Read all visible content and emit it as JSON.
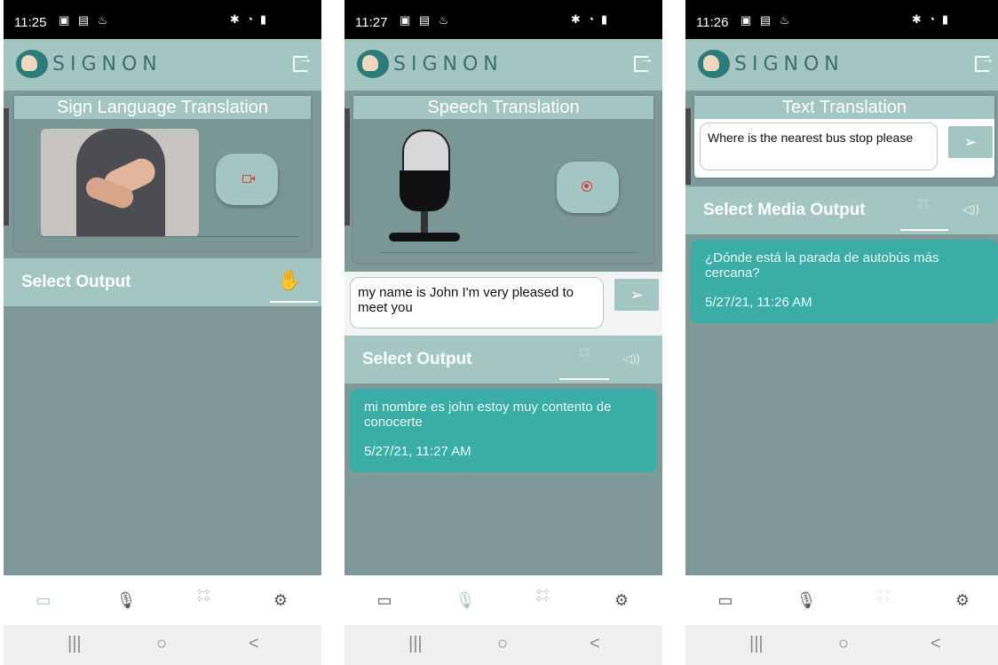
{
  "screens": [
    {
      "status_time": "11:25",
      "brand": "SIGNON",
      "title": "Sign Language Translation",
      "output_label": "Select Output"
    },
    {
      "status_time": "11:27",
      "brand": "SIGNON",
      "title": "Speech Translation",
      "input_text": "my name is John I'm very pleased to meet you",
      "output_label": "Select Output",
      "message": "mi nombre es john estoy muy contento de conocerte",
      "message_time": "5/27/21, 11:27 AM"
    },
    {
      "status_time": "11:26",
      "brand": "SIGNON",
      "title": "Text Translation",
      "input_text": "Where is the nearest bus stop please",
      "output_label": "Select Media Output",
      "message": "¿Dónde está la parada de autobús más cercana?",
      "message_time": "5/27/21, 11:26 AM"
    }
  ],
  "icons": {
    "video": "video-icon",
    "mic": "microphone-icon",
    "braille": "braille-grid-icon",
    "settings": "gear-icon",
    "hand": "hand-icon",
    "speaker": "speaker-icon",
    "send": "send-icon",
    "logout": "logout-icon"
  },
  "colors": {
    "appbar": "#a4c6c2",
    "content_bg": "#7e9998",
    "bubble": "#3aada6",
    "brand_text": "#3b706e",
    "active_nav": "#a4c6c2",
    "record": "#d63a3a"
  },
  "bottom_nav": [
    "Video",
    "Speech",
    "Text",
    "Settings"
  ],
  "system_nav": [
    "|||",
    "○",
    "<"
  ]
}
